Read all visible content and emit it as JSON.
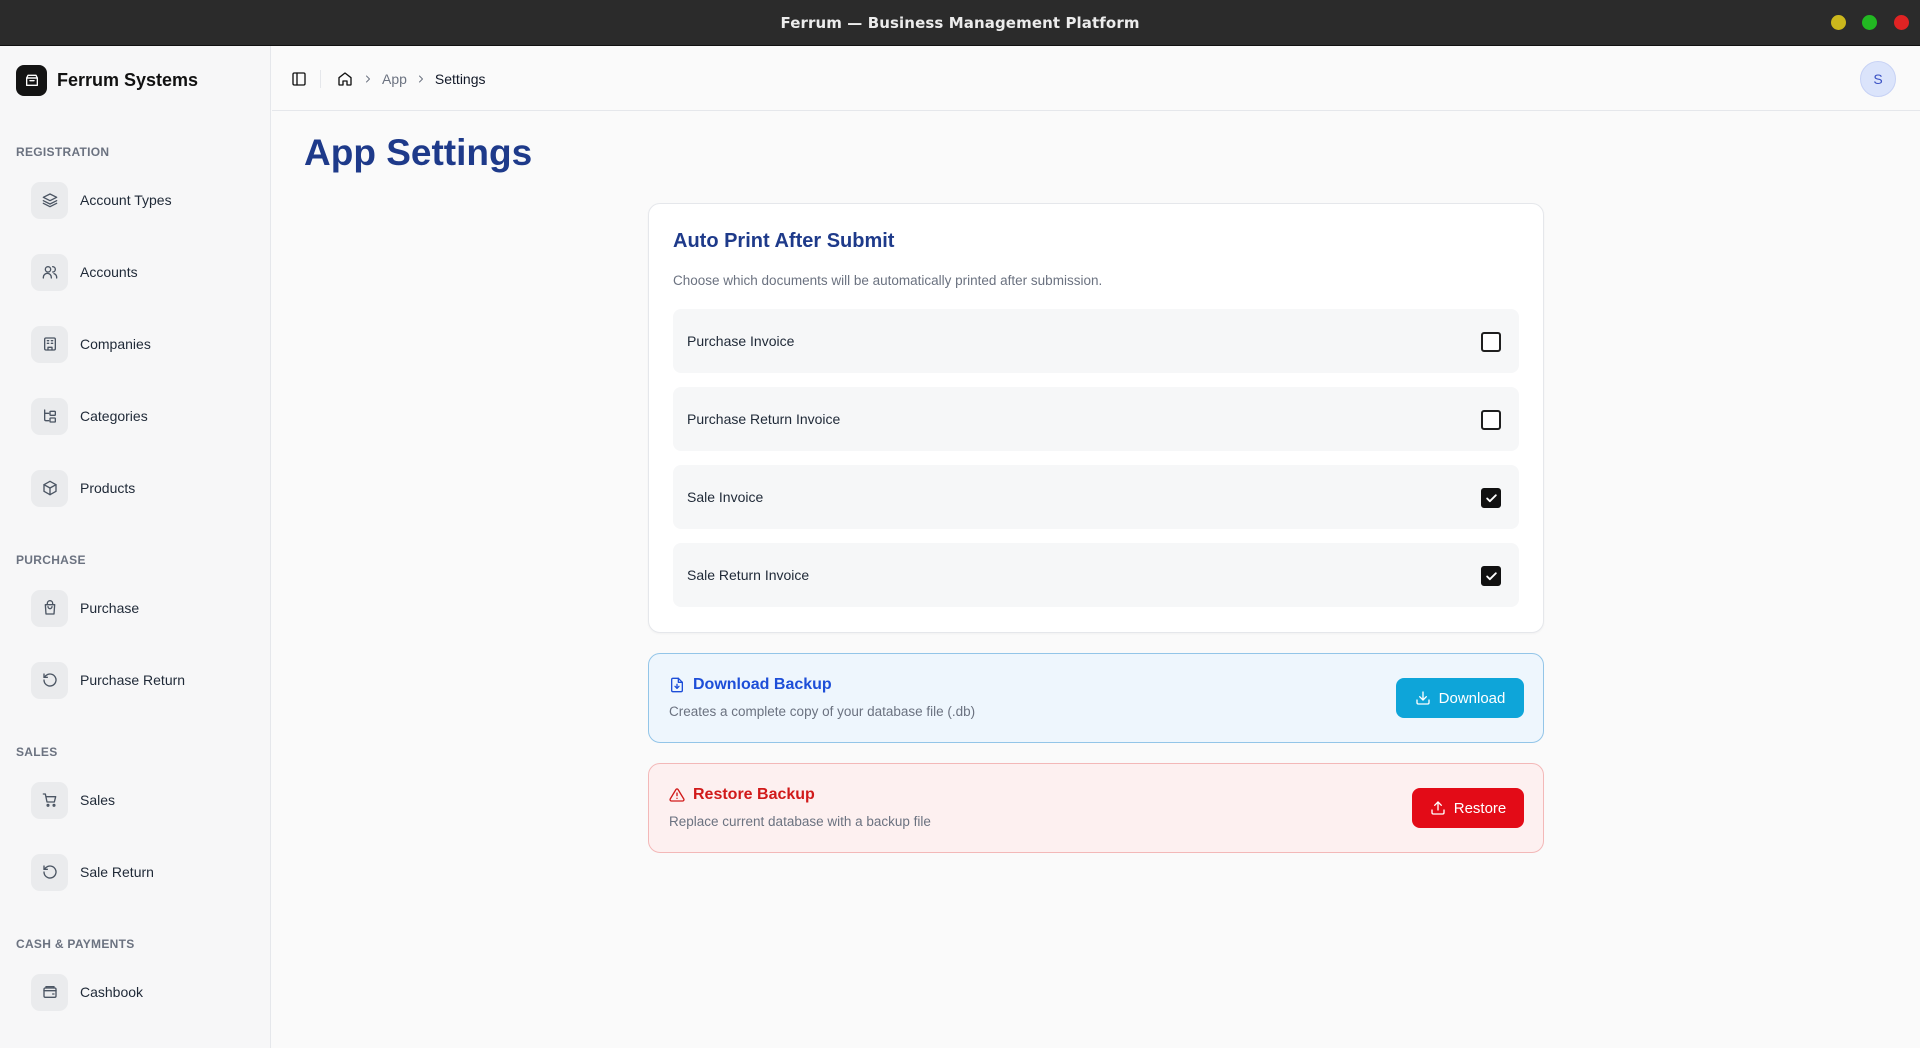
{
  "window": {
    "title": "Ferrum — Business Management Platform"
  },
  "sidebar": {
    "brand": "Ferrum Systems",
    "sections": [
      {
        "label": "REGISTRATION",
        "items": [
          {
            "label": "Account Types",
            "icon": "layers-icon"
          },
          {
            "label": "Accounts",
            "icon": "users-icon"
          },
          {
            "label": "Companies",
            "icon": "building-icon"
          },
          {
            "label": "Categories",
            "icon": "category-tree-icon"
          },
          {
            "label": "Products",
            "icon": "package-icon"
          }
        ]
      },
      {
        "label": "PURCHASE",
        "items": [
          {
            "label": "Purchase",
            "icon": "shopping-bag-icon"
          },
          {
            "label": "Purchase Return",
            "icon": "rotate-ccw-icon"
          }
        ]
      },
      {
        "label": "SALES",
        "items": [
          {
            "label": "Sales",
            "icon": "shopping-cart-icon"
          },
          {
            "label": "Sale Return",
            "icon": "rotate-ccw-icon"
          }
        ]
      },
      {
        "label": "CASH & PAYMENTS",
        "items": [
          {
            "label": "Cashbook",
            "icon": "wallet-icon"
          }
        ]
      }
    ]
  },
  "header": {
    "breadcrumb": [
      "App",
      "Settings"
    ],
    "avatar_initial": "S"
  },
  "main": {
    "title": "App Settings",
    "auto_print": {
      "title": "Auto Print After Submit",
      "description": "Choose which documents will be automatically printed after submission.",
      "options": [
        {
          "label": "Purchase Invoice",
          "checked": false
        },
        {
          "label": "Purchase Return Invoice",
          "checked": false
        },
        {
          "label": "Sale Invoice",
          "checked": true
        },
        {
          "label": "Sale Return Invoice",
          "checked": true
        }
      ]
    },
    "download_backup": {
      "title": "Download Backup",
      "description": "Creates a complete copy of your database file (.db)",
      "button": "Download"
    },
    "restore_backup": {
      "title": "Restore Backup",
      "description": "Replace current database with a backup file",
      "button": "Restore"
    }
  },
  "colors": {
    "title": "#1e3a8a",
    "download_button": "#0ea5d9",
    "restore_button": "#e30b17"
  }
}
